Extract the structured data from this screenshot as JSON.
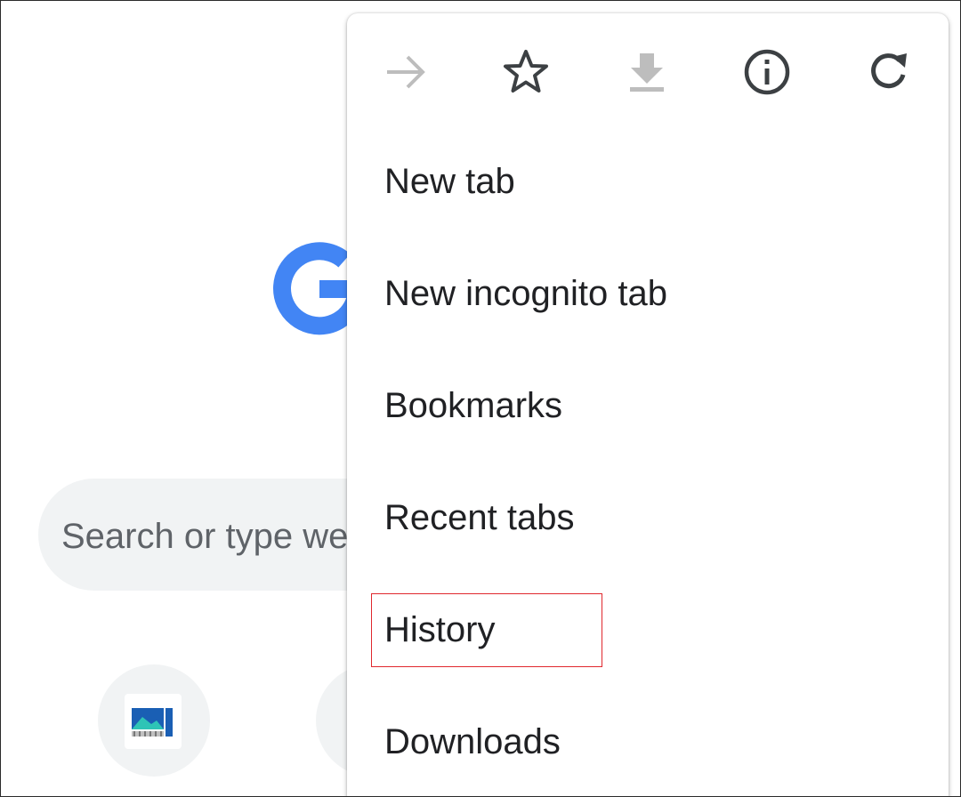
{
  "background": {
    "search_placeholder": "Search or type we",
    "logo_color": "#4285f4",
    "search_bg": "#f1f3f4"
  },
  "toolbar": [
    {
      "name": "forward",
      "icon": "arrow-right-icon",
      "enabled": false
    },
    {
      "name": "bookmark",
      "icon": "star-outline-icon",
      "enabled": true
    },
    {
      "name": "download",
      "icon": "download-icon",
      "enabled": false
    },
    {
      "name": "page-info",
      "icon": "info-icon",
      "enabled": true
    },
    {
      "name": "reload",
      "icon": "refresh-icon",
      "enabled": true
    }
  ],
  "menu": {
    "items": [
      {
        "label": "New tab"
      },
      {
        "label": "New incognito tab"
      },
      {
        "label": "Bookmarks"
      },
      {
        "label": "Recent tabs"
      },
      {
        "label": "History",
        "highlighted": true
      },
      {
        "label": "Downloads"
      }
    ]
  },
  "colors": {
    "text": "#202124",
    "icon_enabled": "#3c4043",
    "icon_disabled": "#bdbdbd",
    "highlight_border": "#e0282e"
  }
}
